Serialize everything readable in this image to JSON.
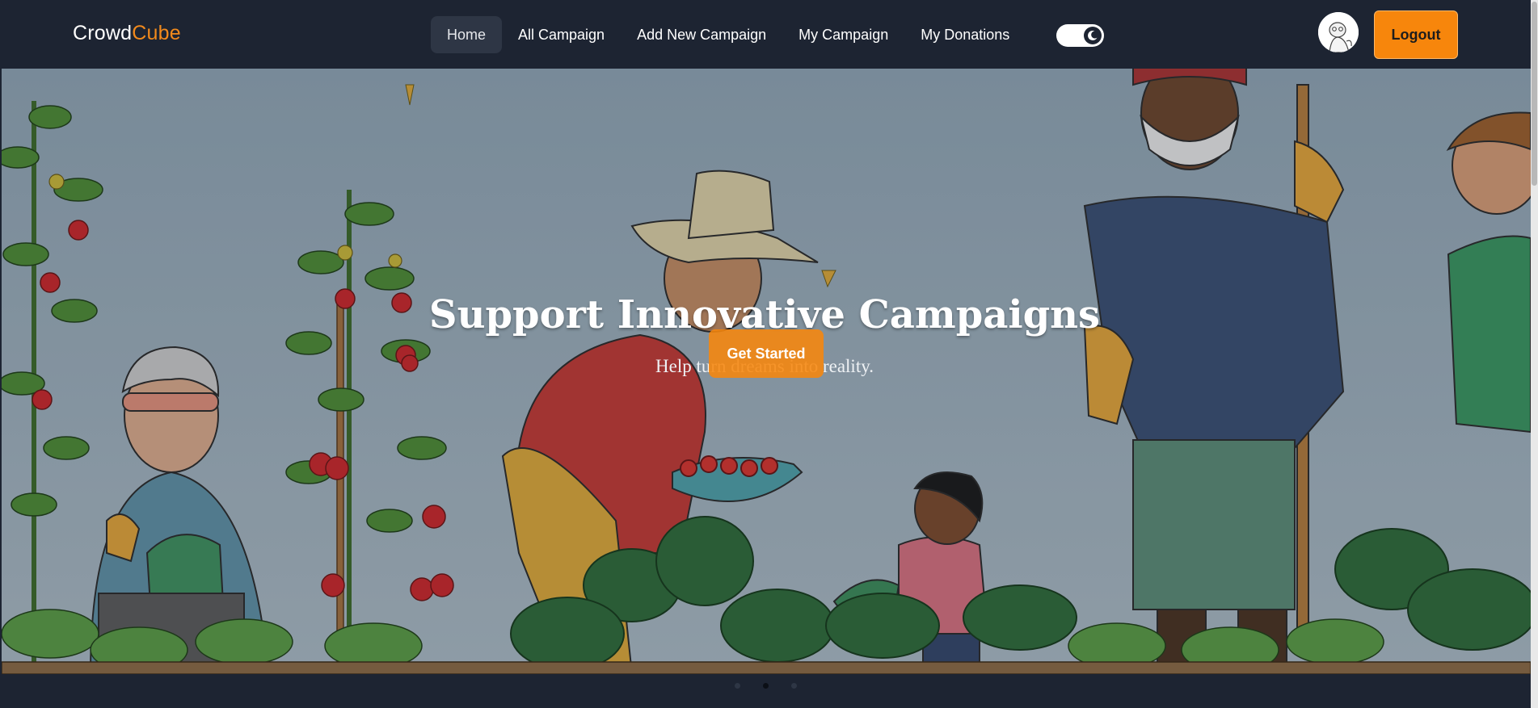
{
  "brand": {
    "part1": "Crowd",
    "part2": "Cube"
  },
  "nav": {
    "links": [
      {
        "label": "Home",
        "active": true
      },
      {
        "label": "All Campaign",
        "active": false
      },
      {
        "label": "Add New Campaign",
        "active": false
      },
      {
        "label": "My Campaign",
        "active": false
      },
      {
        "label": "My Donations",
        "active": false
      }
    ],
    "theme_toggle": {
      "state": "dark",
      "icon": "moon-icon"
    },
    "logout_label": "Logout"
  },
  "hero": {
    "title": "Support Innovative Campaigns",
    "subtitle": "Help turn dreams into reality.",
    "cta_label": "Get Started",
    "illustration": "community-garden-illustration"
  },
  "carousel": {
    "slides": 3,
    "active_index": 1
  },
  "colors": {
    "accent": "#f7860c",
    "navbar_bg": "#1d2432"
  }
}
